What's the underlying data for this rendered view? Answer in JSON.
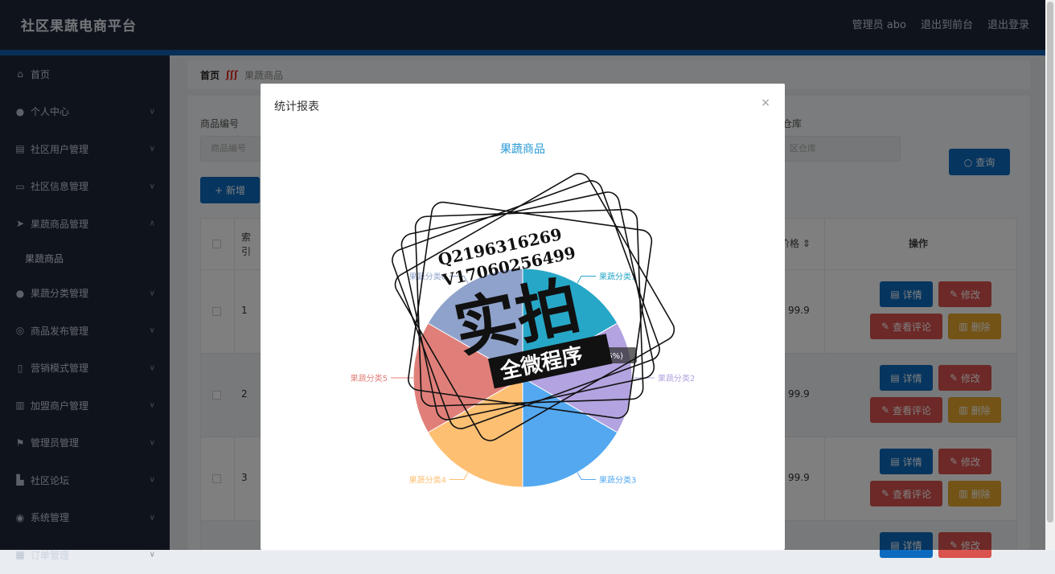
{
  "header": {
    "brand": "社区果蔬电商平台",
    "admin": "管理员 abo",
    "front": "退出到前台",
    "logout": "退出登录"
  },
  "sidebar": {
    "items": [
      {
        "label": "首页",
        "icon": "home-icon"
      },
      {
        "label": "个人中心",
        "icon": "user-icon"
      },
      {
        "label": "社区用户管理",
        "icon": "list-icon"
      },
      {
        "label": "社区信息管理",
        "icon": "message-icon"
      },
      {
        "label": "果蔬商品管理",
        "icon": "send-icon"
      }
    ],
    "sub_item": "果蔬商品",
    "items2": [
      {
        "label": "果蔬分类管理",
        "icon": "user-icon"
      },
      {
        "label": "商品发布管理",
        "icon": "globe-icon"
      },
      {
        "label": "营销模式管理",
        "icon": "phone-icon"
      },
      {
        "label": "加盟商户管理",
        "icon": "chart-icon"
      },
      {
        "label": "管理员管理",
        "icon": "flag-icon"
      },
      {
        "label": "社区论坛",
        "icon": "building-icon"
      },
      {
        "label": "系统管理",
        "icon": "compass-icon"
      },
      {
        "label": "订单管理",
        "icon": "order-icon"
      }
    ]
  },
  "breadcrumb": {
    "home": "首页",
    "current": "果蔬商品"
  },
  "search": {
    "code_label": "商品编号",
    "code_placeholder": "商品编号",
    "ware_label": "仓库",
    "ware_placeholder": "区仓库",
    "query": "查询",
    "add": "新增"
  },
  "table": {
    "header_index": "索引",
    "header_price": "价格",
    "header_ops": "操作",
    "rows": [
      {
        "index": "1",
        "price": "99.9"
      },
      {
        "index": "2",
        "price": "99.9"
      },
      {
        "index": "3",
        "price": "99.9"
      }
    ],
    "btn_detail": "详情",
    "btn_edit": "修改",
    "btn_comment": "查看评论",
    "btn_delete": "删除"
  },
  "modal": {
    "title": "统计报表",
    "close": "×"
  },
  "watermark": {
    "line1": "Q2196316269",
    "line2": "V17060256499",
    "big": "实拍",
    "ribbon": "全微程序"
  },
  "chart_data": {
    "type": "pie",
    "title": "果蔬商品",
    "categories": [
      "果蔬分类1",
      "果蔬分类2",
      "果蔬分类3",
      "果蔬分类4",
      "果蔬分类5",
      "果蔬分类6"
    ],
    "values": [
      1,
      1,
      1,
      1,
      1,
      1
    ],
    "colors": [
      "#27a7c7",
      "#b3a3e0",
      "#54a8f0",
      "#fdbf72",
      "#e07f79",
      "#8fa2cb"
    ],
    "tooltip": ": 1 (16.66%)"
  }
}
